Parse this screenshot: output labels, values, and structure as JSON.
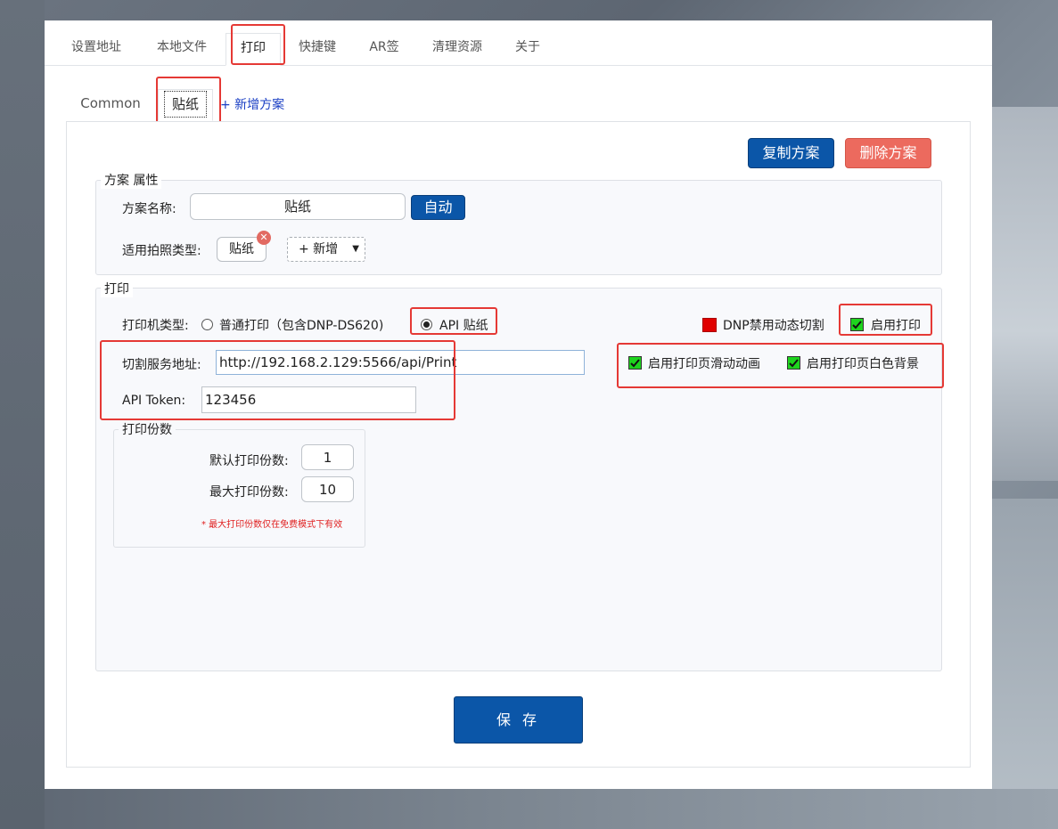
{
  "top_tabs": [
    "设置地址",
    "本地文件",
    "打印",
    "快捷键",
    "AR签",
    "清理资源",
    "关于"
  ],
  "sub_tabs": {
    "common": "Common",
    "sticker": "贴纸",
    "add": "+ 新增方案"
  },
  "actions": {
    "copy": "复制方案",
    "delete": "删除方案",
    "save": "保 存"
  },
  "scheme_props": {
    "legend": "方案 属性",
    "name_label": "方案名称:",
    "name_value": "贴纸",
    "auto": "自动",
    "type_label": "适用拍照类型:",
    "type_chip": "贴纸",
    "add_type": "+ 新增"
  },
  "print": {
    "legend": "打印",
    "printer_type_label": "打印机类型:",
    "option_normal": "普通打印（包含DNP-DS620)",
    "option_api": "API 贴纸",
    "dnp_label": "DNP禁用动态切割",
    "enable_print": "启用打印",
    "cut_service_label": "切割服务地址:",
    "cut_service_value": "http://192.168.2.129:5566/api/Print",
    "token_label": "API Token:",
    "token_value": "123456",
    "slide_anim": "启用打印页滑动动画",
    "white_bg": "启用打印页白色背景"
  },
  "copies": {
    "legend": "打印份数",
    "default_label": "默认打印份数:",
    "default_value": "1",
    "max_label": "最大打印份数:",
    "max_value": "10",
    "note": "* 最大打印份数仅在免费模式下有效"
  },
  "colors": {
    "primary": "#0b56a8",
    "danger": "#ec6a5e",
    "highlight": "#e53935",
    "check": "#1ed41e"
  }
}
